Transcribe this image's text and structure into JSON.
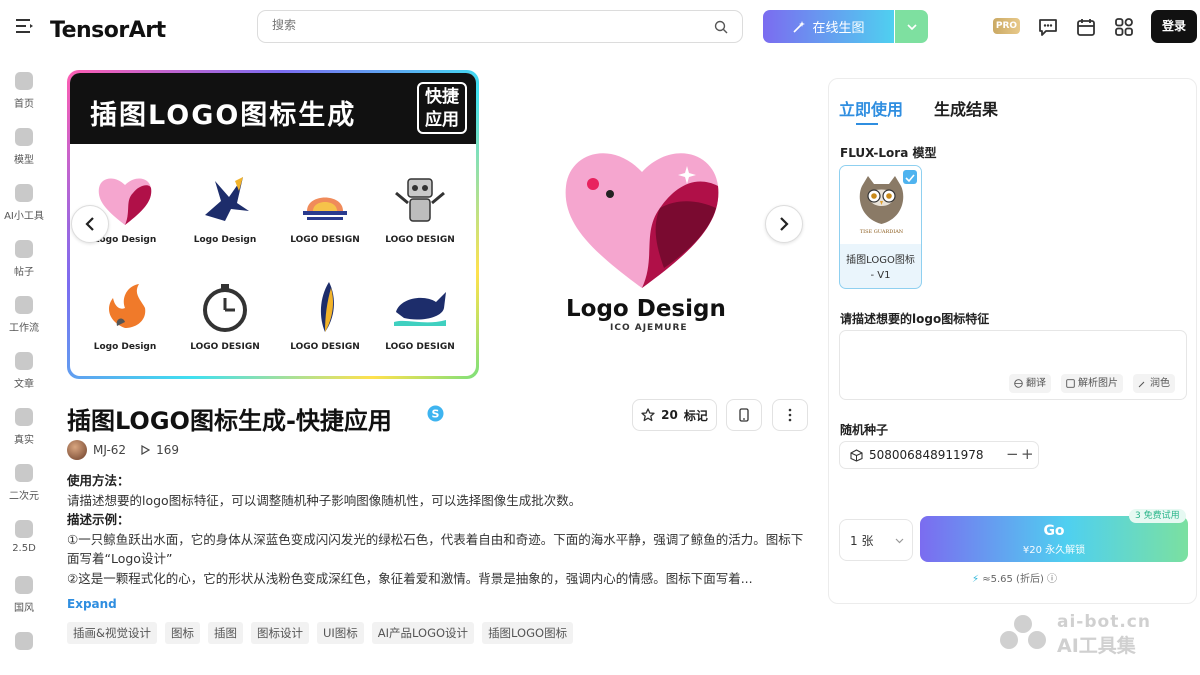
{
  "header": {
    "logo_text": "TensorArt",
    "search_placeholder": "搜索",
    "generate_label": "在线生图",
    "pro_label": "PRO",
    "login_label": "登录"
  },
  "sidebar": {
    "items": [
      {
        "label": "首页"
      },
      {
        "label": "模型"
      },
      {
        "label": "AI小工具"
      },
      {
        "label": "帖子"
      },
      {
        "label": "工作流"
      },
      {
        "label": "文章"
      },
      {
        "label": "真实"
      },
      {
        "label": "二次元"
      },
      {
        "label": "2.5D"
      },
      {
        "label": "国风"
      }
    ]
  },
  "banner": {
    "title": "插图LOGO图标生成",
    "tag_line1": "快捷",
    "tag_line2": "应用",
    "grid": [
      {
        "caption": "Logo Design"
      },
      {
        "caption": "Logo Design"
      },
      {
        "caption": "LOGO DESIGN"
      },
      {
        "caption": "LOGO DESIGN"
      },
      {
        "caption": "Logo Design"
      },
      {
        "caption": "LOGO DESIGN"
      },
      {
        "caption": "LOGO DESIGN"
      },
      {
        "caption": "LOGO DESIGN"
      }
    ],
    "preview_caption": "Logo Design",
    "preview_sub": "ICO AJEMURE"
  },
  "detail": {
    "title": "插图LOGO图标生成-快捷应用",
    "star_count": "20",
    "star_label": "标记",
    "author": "MJ-62",
    "play_count": "169",
    "usage_heading": "使用方法：",
    "usage_text": "请描述想要的logo图标特征，可以调整随机种子影响图像随机性，可以选择图像生成批次数。",
    "example_heading": "描述示例：",
    "example_1": "①一只鲸鱼跃出水面，它的身体从深蓝色变成闪闪发光的绿松石色，代表着自由和奇迹。下面的海水平静，强调了鲸鱼的活力。图标下面写着“Logo设计”",
    "example_2": "②这是一颗程式化的心，它的形状从浅粉色变成深红色，象征着爱和激情。背景是抽象的，强调内心的情感。图标下面写着...",
    "expand_label": "Expand",
    "tags": [
      "插画&视觉设计",
      "图标",
      "插图",
      "图标设计",
      "UI图标",
      "AI产品LOGO设计",
      "插图LOGO图标"
    ]
  },
  "panel": {
    "tab_use": "立即使用",
    "tab_result": "生成结果",
    "model_label": "FLUX-Lora 模型",
    "model_name_line1": "插图LOGO图标",
    "model_name_line2": "- V1",
    "model_img_text": "TISE GUARDIAN",
    "prompt_label": "请描述想要的logo图标特征",
    "btn_translate": "翻译",
    "btn_parse": "解析图片",
    "btn_polish": "润色",
    "seed_label": "随机种子",
    "seed_value": "508006848911978",
    "count_value": "1 张",
    "go_label": "Go",
    "go_sub": "¥20 永久解锁",
    "free_badge": "3 免费试用",
    "price": "≈5.65 (折后)"
  },
  "watermark": {
    "line1": "ai-bot.cn",
    "line2": "AI工具集"
  },
  "colors": {
    "accent": "#2f8ee0",
    "go_gradient_start": "#7b6cf0",
    "go_gradient_end": "#7be0a0"
  }
}
